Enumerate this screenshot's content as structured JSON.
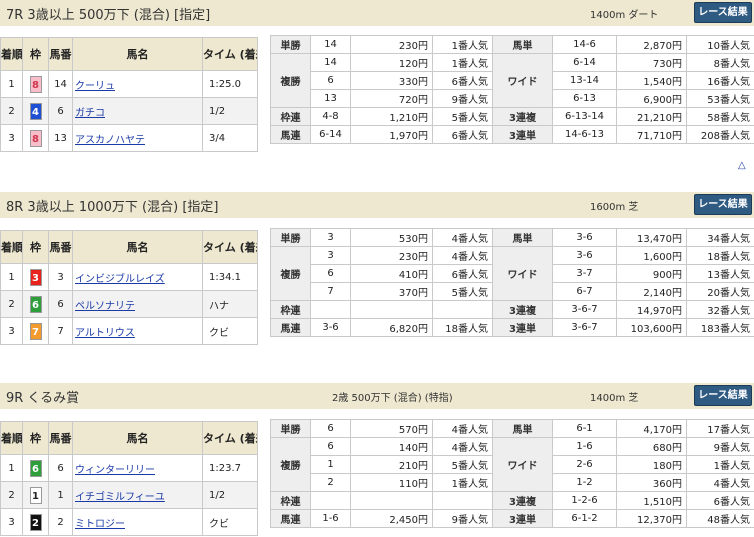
{
  "races": [
    {
      "title": "7R 3歳以上 500万下 (混合) [指定]",
      "conditions": "",
      "distance": "1400m  ダート",
      "button_label": "レース結果",
      "headers": {
        "rank": "着順",
        "waku": "枠",
        "num": "馬番",
        "name": "馬名",
        "time": "タイム (着差)"
      },
      "results": [
        {
          "rank": "1",
          "waku": "8",
          "waku_bg": "#f7bdc8",
          "waku_fg": "#d0354f",
          "num": "14",
          "name": "クーリュ",
          "time": "1:25.0"
        },
        {
          "rank": "2",
          "waku": "4",
          "waku_bg": "#1f4fd3",
          "waku_fg": "#ffffff",
          "num": "6",
          "name": "ガチコ",
          "time": "1/2"
        },
        {
          "rank": "3",
          "waku": "8",
          "waku_bg": "#f7bdc8",
          "waku_fg": "#d0354f",
          "num": "13",
          "name": "アスカノハヤテ",
          "time": "3/4"
        }
      ],
      "payouts": {
        "win": {
          "label": "単勝",
          "combo": "14",
          "amount": "230円",
          "pop": "1番人気"
        },
        "place": {
          "label": "複勝",
          "rows": [
            {
              "combo": "14",
              "amount": "120円",
              "pop": "1番人気"
            },
            {
              "combo": "6",
              "amount": "330円",
              "pop": "6番人気"
            },
            {
              "combo": "13",
              "amount": "720円",
              "pop": "9番人気"
            }
          ]
        },
        "bracket": {
          "label": "枠連",
          "combo": "4-8",
          "amount": "1,210円",
          "pop": "5番人気"
        },
        "quinella": {
          "label": "馬連",
          "combo": "6-14",
          "amount": "1,970円",
          "pop": "6番人気"
        },
        "exacta": {
          "label": "馬単",
          "combo": "14-6",
          "amount": "2,870円",
          "pop": "10番人気"
        },
        "wide": {
          "label": "ワイド",
          "rows": [
            {
              "combo": "6-14",
              "amount": "730円",
              "pop": "8番人気"
            },
            {
              "combo": "13-14",
              "amount": "1,540円",
              "pop": "16番人気"
            },
            {
              "combo": "6-13",
              "amount": "6,900円",
              "pop": "53番人気"
            }
          ]
        },
        "trio": {
          "label": "3連複",
          "combo": "6-13-14",
          "amount": "21,210円",
          "pop": "58番人気"
        },
        "trifecta": {
          "label": "3連単",
          "combo": "14-6-13",
          "amount": "71,710円",
          "pop": "208番人気"
        }
      },
      "up_link": "△"
    },
    {
      "title": "8R 3歳以上 1000万下 (混合) [指定]",
      "conditions": "",
      "distance": "1600m  芝",
      "button_label": "レース結果",
      "headers": {
        "rank": "着順",
        "waku": "枠",
        "num": "馬番",
        "name": "馬名",
        "time": "タイム (着差)"
      },
      "results": [
        {
          "rank": "1",
          "waku": "3",
          "waku_bg": "#e8221c",
          "waku_fg": "#ffffff",
          "num": "3",
          "name": "インビジブルレイズ",
          "time": "1:34.1"
        },
        {
          "rank": "2",
          "waku": "6",
          "waku_bg": "#2e9e3a",
          "waku_fg": "#ffffff",
          "num": "6",
          "name": "ペルソナリテ",
          "time": "ハナ"
        },
        {
          "rank": "3",
          "waku": "7",
          "waku_bg": "#f39a2f",
          "waku_fg": "#ffffff",
          "num": "7",
          "name": "アルトリウス",
          "time": "クビ"
        }
      ],
      "payouts": {
        "win": {
          "label": "単勝",
          "combo": "3",
          "amount": "530円",
          "pop": "4番人気"
        },
        "place": {
          "label": "複勝",
          "rows": [
            {
              "combo": "3",
              "amount": "230円",
              "pop": "4番人気"
            },
            {
              "combo": "6",
              "amount": "410円",
              "pop": "6番人気"
            },
            {
              "combo": "7",
              "amount": "370円",
              "pop": "5番人気"
            }
          ]
        },
        "bracket": {
          "label": "枠連",
          "combo": "",
          "amount": "",
          "pop": ""
        },
        "quinella": {
          "label": "馬連",
          "combo": "3-6",
          "amount": "6,820円",
          "pop": "18番人気"
        },
        "exacta": {
          "label": "馬単",
          "combo": "3-6",
          "amount": "13,470円",
          "pop": "34番人気"
        },
        "wide": {
          "label": "ワイド",
          "rows": [
            {
              "combo": "3-6",
              "amount": "1,600円",
              "pop": "18番人気"
            },
            {
              "combo": "3-7",
              "amount": "900円",
              "pop": "13番人気"
            },
            {
              "combo": "6-7",
              "amount": "2,140円",
              "pop": "20番人気"
            }
          ]
        },
        "trio": {
          "label": "3連複",
          "combo": "3-6-7",
          "amount": "14,970円",
          "pop": "32番人気"
        },
        "trifecta": {
          "label": "3連単",
          "combo": "3-6-7",
          "amount": "103,600円",
          "pop": "183番人気"
        }
      },
      "up_link": ""
    },
    {
      "title": "9R くるみ賞",
      "conditions": "2歳 500万下 (混合) (特指)",
      "distance": "1400m  芝",
      "button_label": "レース結果",
      "headers": {
        "rank": "着順",
        "waku": "枠",
        "num": "馬番",
        "name": "馬名",
        "time": "タイム (着差)"
      },
      "results": [
        {
          "rank": "1",
          "waku": "6",
          "waku_bg": "#2e9e3a",
          "waku_fg": "#ffffff",
          "num": "6",
          "name": "ウィンターリリー",
          "time": "1:23.7"
        },
        {
          "rank": "2",
          "waku": "1",
          "waku_bg": "#ffffff",
          "waku_fg": "#222222",
          "num": "1",
          "name": "イチゴミルフィーユ",
          "time": "1/2"
        },
        {
          "rank": "3",
          "waku": "2",
          "waku_bg": "#111111",
          "waku_fg": "#ffffff",
          "num": "2",
          "name": "ミトロジー",
          "time": "クビ"
        }
      ],
      "payouts": {
        "win": {
          "label": "単勝",
          "combo": "6",
          "amount": "570円",
          "pop": "4番人気"
        },
        "place": {
          "label": "複勝",
          "rows": [
            {
              "combo": "6",
              "amount": "140円",
              "pop": "4番人気"
            },
            {
              "combo": "1",
              "amount": "210円",
              "pop": "5番人気"
            },
            {
              "combo": "2",
              "amount": "110円",
              "pop": "1番人気"
            }
          ]
        },
        "bracket": {
          "label": "枠連",
          "combo": "",
          "amount": "",
          "pop": ""
        },
        "quinella": {
          "label": "馬連",
          "combo": "1-6",
          "amount": "2,450円",
          "pop": "9番人気"
        },
        "exacta": {
          "label": "馬単",
          "combo": "6-1",
          "amount": "4,170円",
          "pop": "17番人気"
        },
        "wide": {
          "label": "ワイド",
          "rows": [
            {
              "combo": "1-6",
              "amount": "680円",
              "pop": "9番人気"
            },
            {
              "combo": "2-6",
              "amount": "180円",
              "pop": "1番人気"
            },
            {
              "combo": "1-2",
              "amount": "360円",
              "pop": "4番人気"
            }
          ]
        },
        "trio": {
          "label": "3連複",
          "combo": "1-2-6",
          "amount": "1,510円",
          "pop": "6番人気"
        },
        "trifecta": {
          "label": "3連単",
          "combo": "6-1-2",
          "amount": "12,370円",
          "pop": "48番人気"
        }
      },
      "up_link": ""
    }
  ]
}
